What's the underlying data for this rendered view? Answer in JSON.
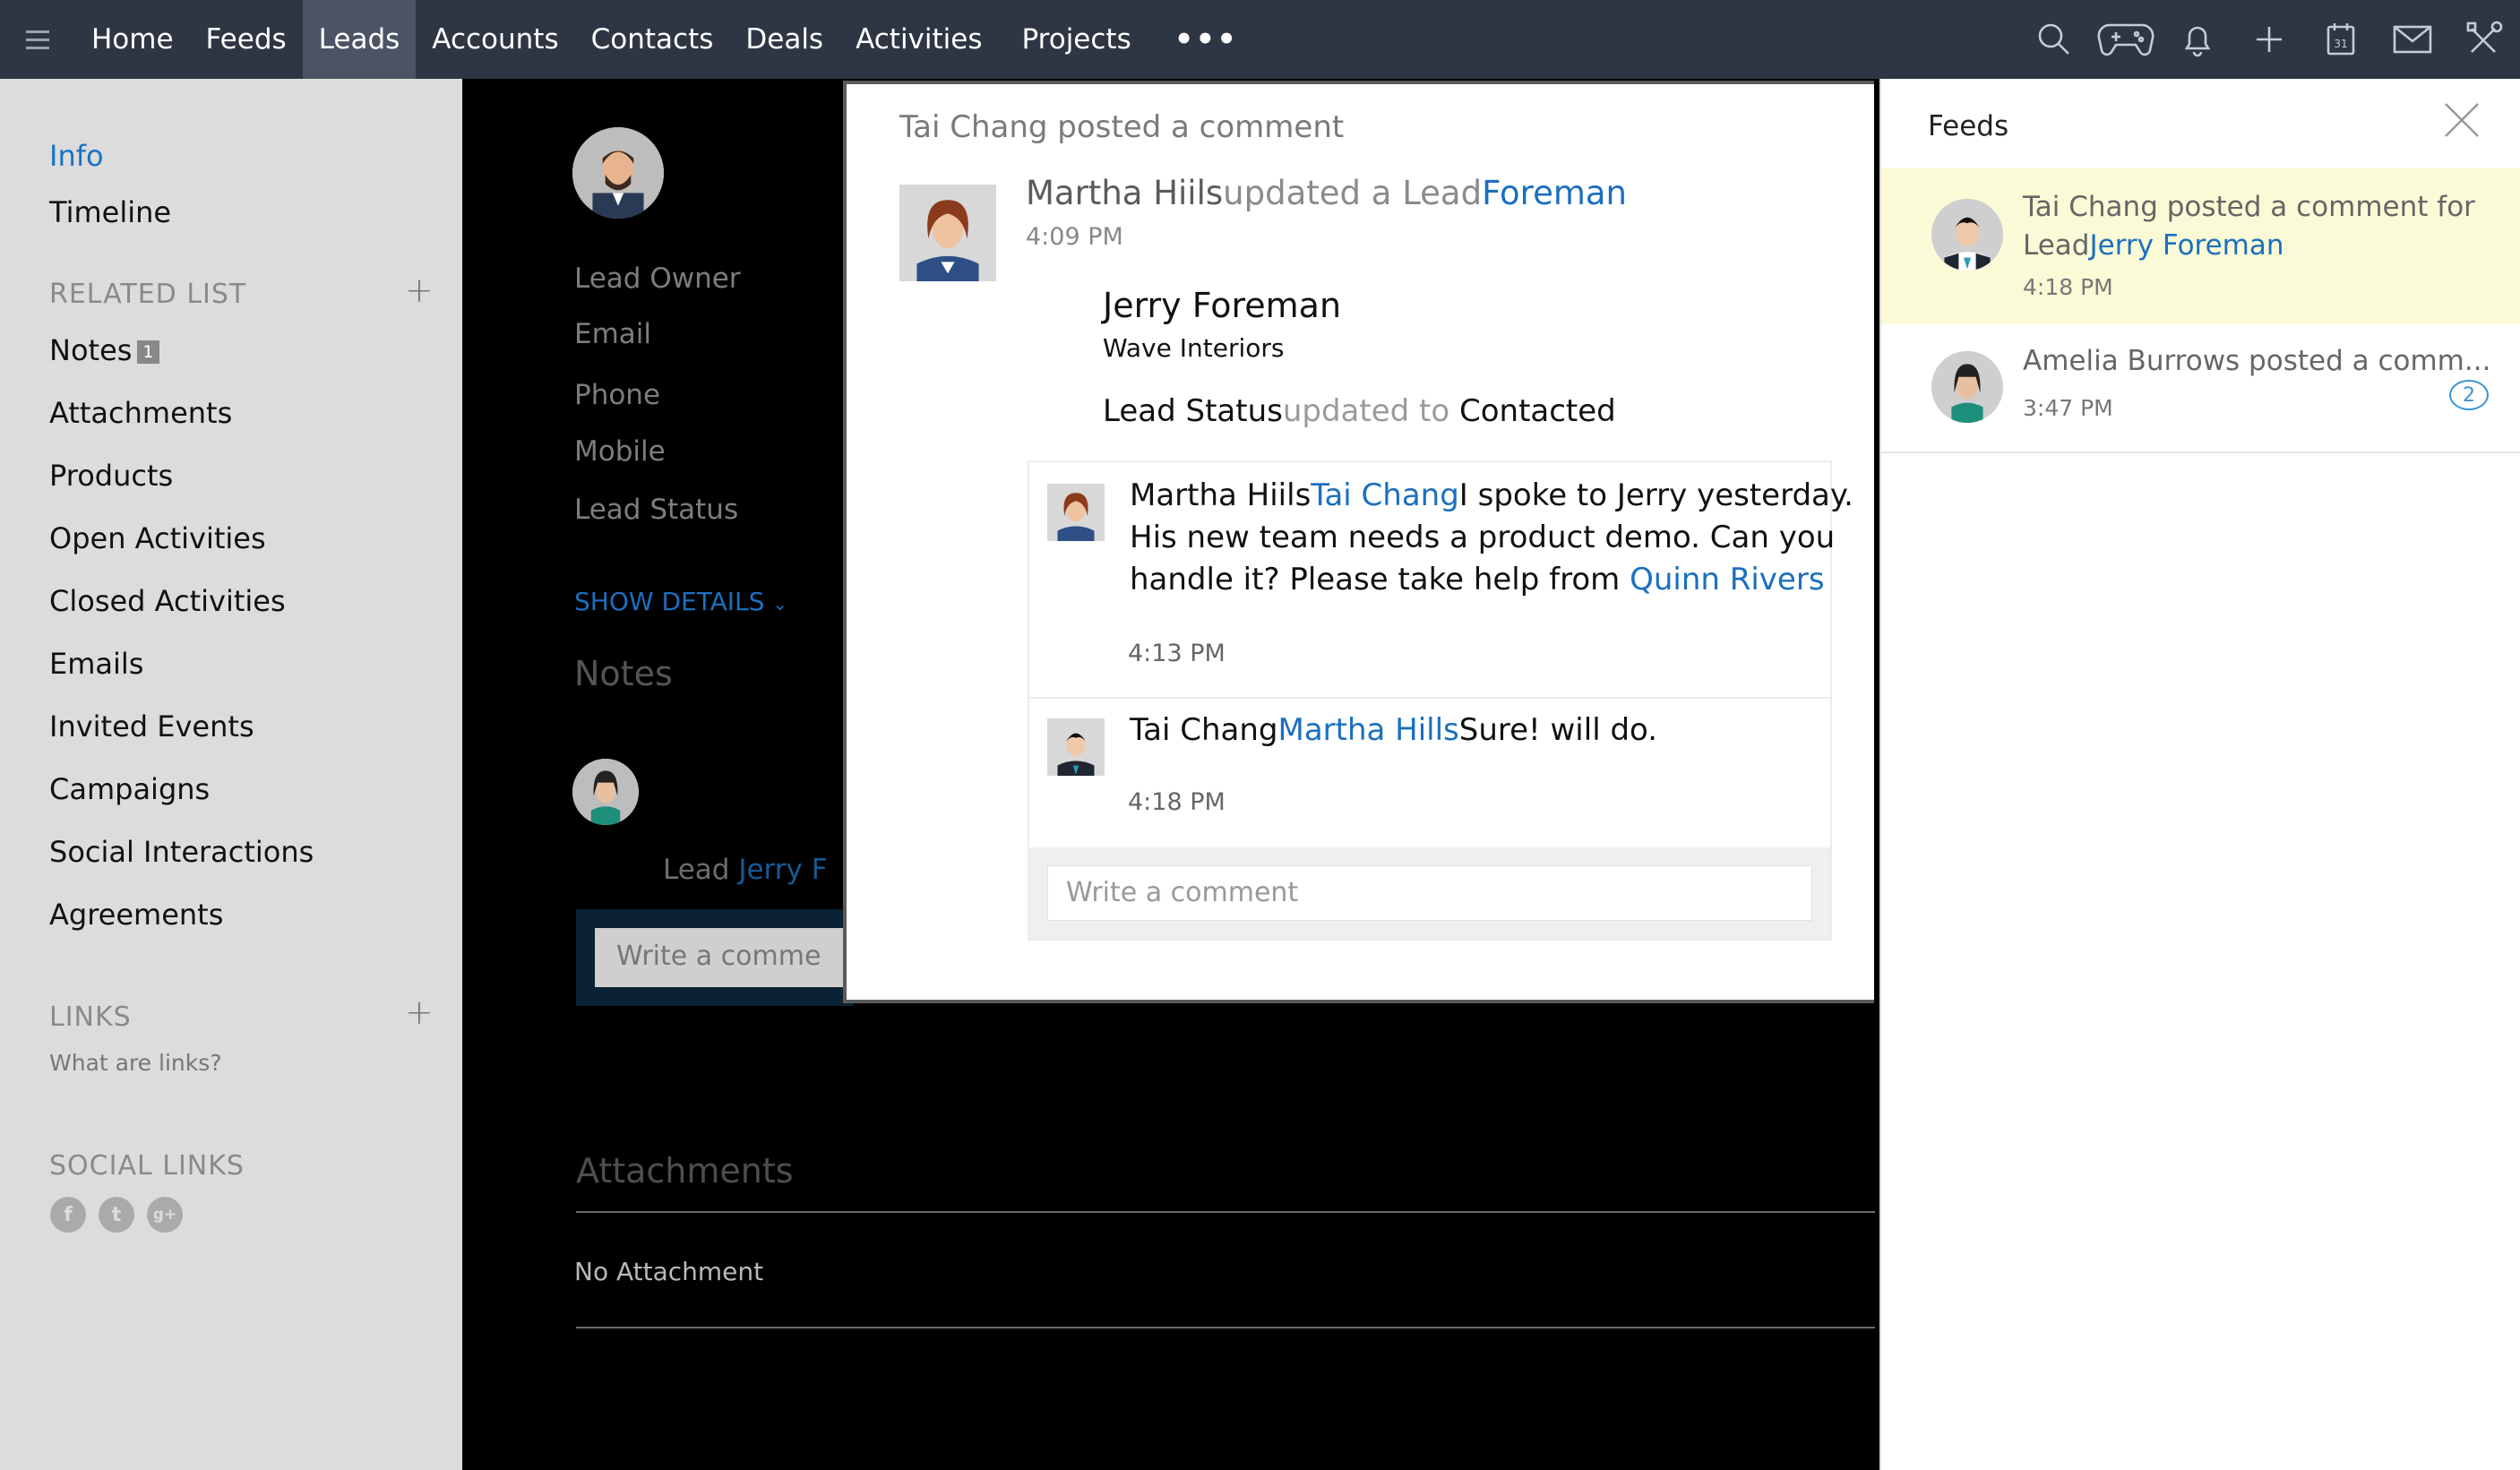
{
  "nav": {
    "items": [
      {
        "label": "Home",
        "active": false
      },
      {
        "label": "Feeds",
        "active": false
      },
      {
        "label": "Leads",
        "active": true
      },
      {
        "label": "Accounts",
        "active": false
      },
      {
        "label": "Contacts",
        "active": false
      },
      {
        "label": "Deals",
        "active": false
      },
      {
        "label": "Activities",
        "active": false
      },
      {
        "label": "Projects",
        "active": false
      }
    ],
    "more_label": "•••",
    "icons": [
      "search-icon",
      "gamepad-icon",
      "bell-icon",
      "plus-icon",
      "calendar-icon",
      "mail-icon",
      "tools-icon"
    ],
    "calendar_day": "31"
  },
  "sidebar": {
    "info_label": "Info",
    "timeline_label": "Timeline",
    "related_header": "RELATED LIST",
    "related": [
      {
        "label": "Notes",
        "badge": "1"
      },
      {
        "label": "Attachments"
      },
      {
        "label": "Products"
      },
      {
        "label": "Open Activities"
      },
      {
        "label": "Closed Activities"
      },
      {
        "label": "Emails"
      },
      {
        "label": "Invited Events"
      },
      {
        "label": "Campaigns"
      },
      {
        "label": "Social Interactions"
      },
      {
        "label": "Agreements"
      }
    ],
    "links_header": "LINKS",
    "links_help": "What are links?",
    "social_header": "SOCIAL LINKS",
    "social_icons": [
      "facebook-icon",
      "twitter-icon",
      "google-plus-icon"
    ]
  },
  "detail": {
    "fields": [
      "Lead Owner",
      "Email",
      "Phone",
      "Mobile",
      "Lead Status"
    ],
    "show_details": "SHOW DETAILS",
    "notes_title": "Notes",
    "note_prefix": "Lead",
    "note_link": "Jerry F",
    "comment_placeholder": "Write a comme",
    "attachments_title": "Attachments",
    "no_attachment": "No Attachment"
  },
  "popup": {
    "title": "Tai Chang posted a comment",
    "author": "Martha Hiils",
    "action": "updated a Lead",
    "link": "Foreman",
    "time": "4:09 PM",
    "lead_name": "Jerry Foreman",
    "company": "Wave Interiors",
    "status_label": "Lead Status",
    "status_mid": "updated to",
    "status_value": "Contacted",
    "comments": [
      {
        "author": "Martha Hiils",
        "mention": "Tai Chang",
        "line1": "I spoke to Jerry yesterday.",
        "line2": "His new team needs a product demo. Can you",
        "line3": "handle it? Please take help from",
        "mention2": "Quinn Rivers",
        "time": "4:13 PM"
      },
      {
        "author": "Tai Chang",
        "mention": "Martha Hills",
        "text": "Sure! will do.",
        "time": "4:18 PM"
      }
    ],
    "write_placeholder": "Write a comment"
  },
  "feeds": {
    "title": "Feeds",
    "items": [
      {
        "text": "Tai Chang posted a comment for",
        "prefix": "Lead",
        "link": "Jerry Foreman",
        "time": "4:18 PM"
      },
      {
        "text": "Amelia Burrows posted a comm...",
        "time": "3:47 PM",
        "count": "2"
      }
    ]
  },
  "colors": {
    "topbar": "#2e3644",
    "accent": "#1b6fbf",
    "highlight": "#fbfad6"
  }
}
